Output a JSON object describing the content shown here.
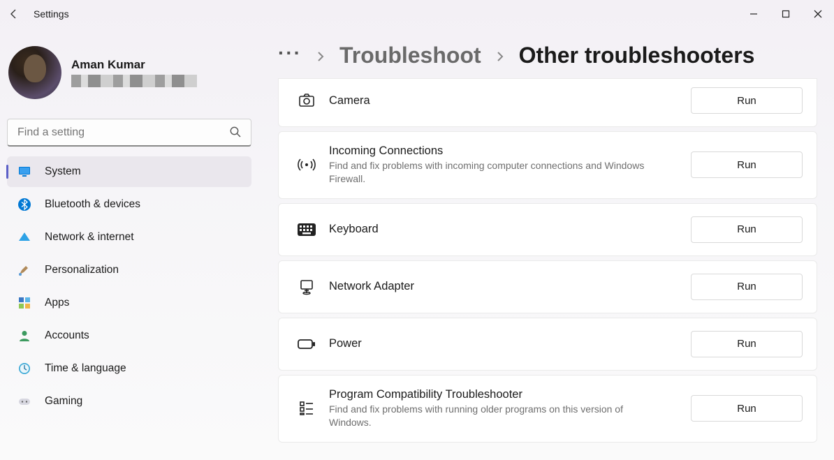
{
  "window": {
    "title": "Settings"
  },
  "profile": {
    "name": "Aman Kumar"
  },
  "search": {
    "placeholder": "Find a setting"
  },
  "sidebar": {
    "items": [
      {
        "label": "System",
        "icon": "monitor",
        "active": true
      },
      {
        "label": "Bluetooth & devices",
        "icon": "bluetooth"
      },
      {
        "label": "Network & internet",
        "icon": "wifi"
      },
      {
        "label": "Personalization",
        "icon": "brush"
      },
      {
        "label": "Apps",
        "icon": "apps"
      },
      {
        "label": "Accounts",
        "icon": "person"
      },
      {
        "label": "Time & language",
        "icon": "clock"
      },
      {
        "label": "Gaming",
        "icon": "gamepad"
      }
    ]
  },
  "breadcrumb": {
    "more": "···",
    "link": "Troubleshoot",
    "current": "Other troubleshooters"
  },
  "items": [
    {
      "icon": "camera",
      "title": "Camera",
      "desc": "",
      "action": "Run"
    },
    {
      "icon": "signal",
      "title": "Incoming Connections",
      "desc": "Find and fix problems with incoming computer connections and Windows Firewall.",
      "action": "Run"
    },
    {
      "icon": "keyboard",
      "title": "Keyboard",
      "desc": "",
      "action": "Run"
    },
    {
      "icon": "adapter",
      "title": "Network Adapter",
      "desc": "",
      "action": "Run"
    },
    {
      "icon": "power",
      "title": "Power",
      "desc": "",
      "action": "Run"
    },
    {
      "icon": "compat",
      "title": "Program Compatibility Troubleshooter",
      "desc": "Find and fix problems with running older programs on this version of Windows.",
      "action": "Run"
    }
  ]
}
